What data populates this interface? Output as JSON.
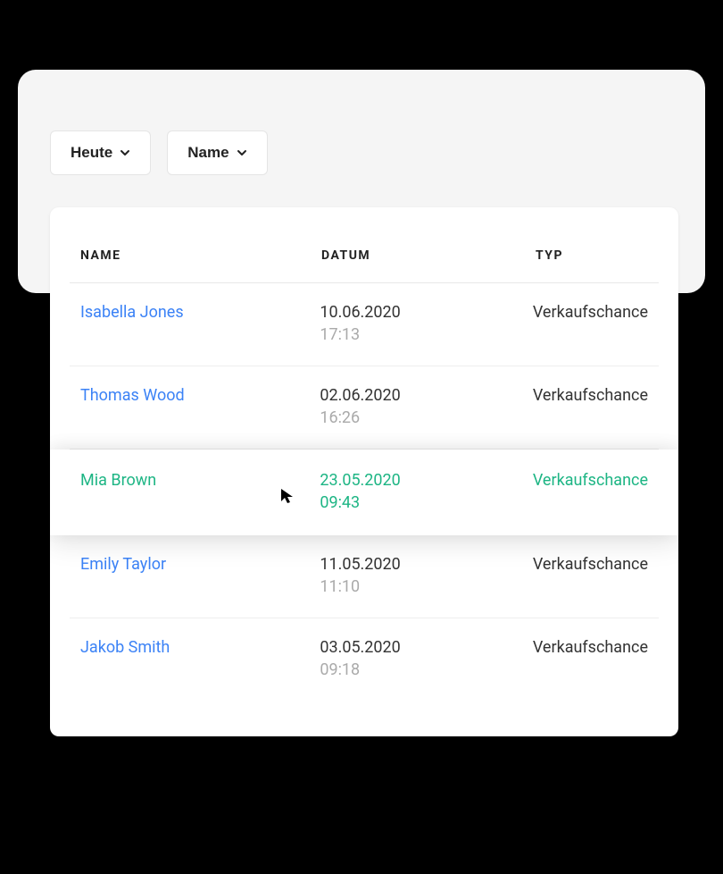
{
  "filters": {
    "date_label": "Heute",
    "sort_label": "Name"
  },
  "columns": {
    "name": "NAME",
    "date": "DATUM",
    "type": "TYP"
  },
  "rows": [
    {
      "name": "Isabella  Jones",
      "date": "10.06.2020",
      "time": "17:13",
      "type": "Verkaufschance",
      "highlighted": false
    },
    {
      "name": "Thomas  Wood",
      "date": "02.06.2020",
      "time": "16:26",
      "type": "Verkaufschance",
      "highlighted": false
    },
    {
      "name": "Mia  Brown",
      "date": "23.05.2020",
      "time": "09:43",
      "type": "Verkaufschance",
      "highlighted": true
    },
    {
      "name": "Emily  Taylor",
      "date": "11.05.2020",
      "time": "11:10",
      "type": "Verkaufschance",
      "highlighted": false
    },
    {
      "name": "Jakob Smith",
      "date": "03.05.2020",
      "time": "09:18",
      "type": "Verkaufschance",
      "highlighted": false
    }
  ]
}
